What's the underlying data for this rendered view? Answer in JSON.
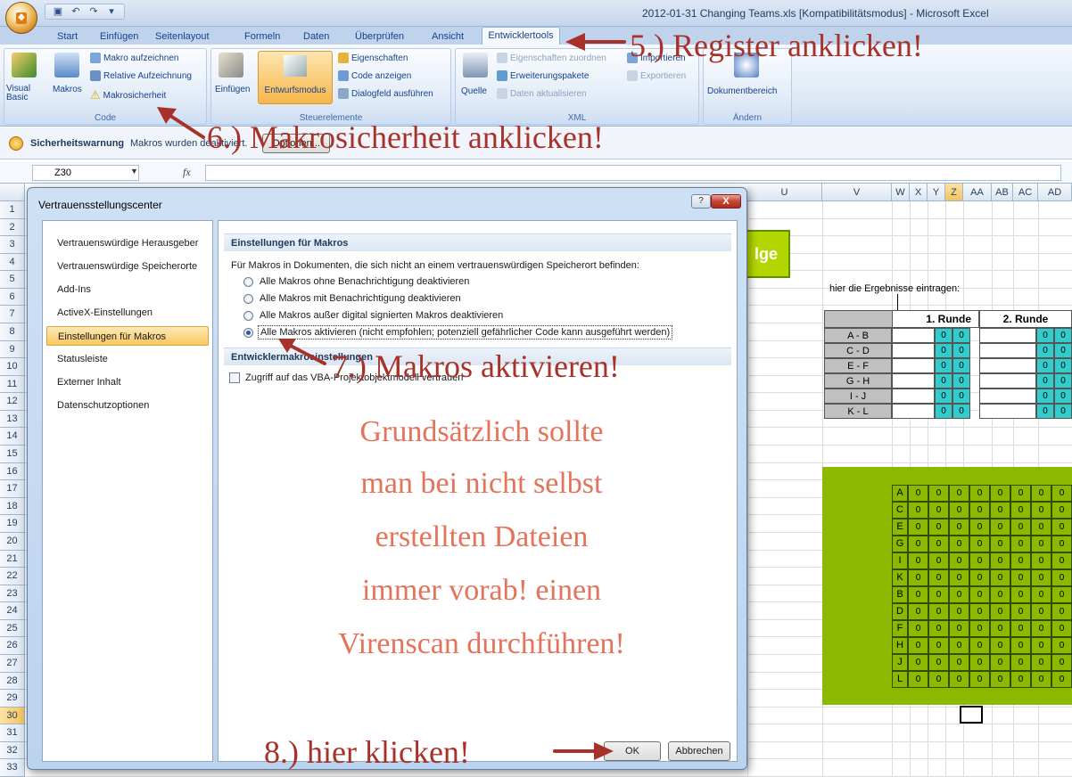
{
  "window": {
    "title": "2012-01-31 Changing Teams.xls [Kompatibilitätsmodus] - Microsoft Excel"
  },
  "ribbon": {
    "tabs": [
      "Start",
      "Einfügen",
      "Seitenlayout",
      "Formeln",
      "Daten",
      "Überprüfen",
      "Ansicht",
      "Entwicklertools"
    ],
    "active_tab": "Entwicklertools",
    "code": {
      "visual_basic": "Visual Basic",
      "makros": "Makros",
      "record": "Makro aufzeichnen",
      "relative": "Relative Aufzeichnung",
      "security": "Makrosicherheit",
      "label": "Code"
    },
    "controls": {
      "insert": "Einfügen",
      "design_mode": "Entwurfsmodus",
      "properties": "Eigenschaften",
      "view_code": "Code anzeigen",
      "run_dialog": "Dialogfeld ausführen",
      "label": "Steuerelemente"
    },
    "xml": {
      "source": "Quelle",
      "map_props": "Eigenschaften zuordnen",
      "expansion": "Erweiterungspakete",
      "refresh": "Daten aktualisieren",
      "import": "Importieren",
      "export": "Exportieren",
      "label": "XML"
    },
    "modify": {
      "doc_panel": "Dokumentbereich",
      "label": "Ändern"
    }
  },
  "security_bar": {
    "title": "Sicherheitswarnung",
    "message": "Makros wurden deaktiviert.",
    "options": "Optionen..."
  },
  "formula_bar": {
    "cell": "Z30",
    "fx": "fx"
  },
  "columns_right": [
    "U",
    "V",
    "W",
    "X",
    "Y",
    "Z",
    "AA",
    "AB",
    "AC",
    "AD"
  ],
  "rows": [
    "1",
    "2",
    "3",
    "4",
    "5",
    "6",
    "7",
    "8",
    "9",
    "10",
    "11",
    "12",
    "13",
    "14",
    "15",
    "16",
    "17",
    "18",
    "19",
    "20",
    "21",
    "22",
    "23",
    "24",
    "25",
    "26",
    "27",
    "28",
    "29",
    "30",
    "31",
    "32",
    "33"
  ],
  "dialog": {
    "title": "Vertrauensstellungscenter",
    "help": "?",
    "close": "X",
    "nav": [
      "Vertrauenswürdige Herausgeber",
      "Vertrauenswürdige Speicherorte",
      "Add-Ins",
      "ActiveX-Einstellungen",
      "Einstellungen für Makros",
      "Statusleiste",
      "Externer Inhalt",
      "Datenschutzoptionen"
    ],
    "selected_nav": "Einstellungen für Makros",
    "section1": "Einstellungen für Makros",
    "intro": "Für Makros in Dokumenten, die sich nicht an einem vertrauenswürdigen Speicherort befinden:",
    "options": [
      "Alle Makros ohne Benachrichtigung deaktivieren",
      "Alle Makros mit Benachrichtigung deaktivieren",
      "Alle Makros außer digital signierten Makros deaktivieren",
      "Alle Makros aktivieren (nicht empfohlen; potenziell gefährlicher Code kann ausgeführt werden)"
    ],
    "selected_option": 3,
    "section2": "Entwicklermakroeinstellungen",
    "vba_trust": "Zugriff auf das VBA-Projektobjektmodell vertrauen",
    "ok": "OK",
    "cancel": "Abbrechen"
  },
  "annotations": {
    "step5": "5.) Register anklicken!",
    "step6": "6.) Makrosicherheit anklicken!",
    "step7": "7.) Makros aktivieren!",
    "step8": "8.) hier klicken!",
    "warning": [
      "Grundsätzlich sollte",
      "man bei nicht selbst",
      "erstellten Dateien",
      "immer vorab! einen",
      "Virenscan durchführen!"
    ]
  },
  "sheet": {
    "banner": "lge",
    "hint": "hier die Ergebnisse eintragen:",
    "round1": "1. Runde",
    "round2": "2. Runde",
    "pairs": [
      "A - B",
      "C - D",
      "E - F",
      "G - H",
      "I - J",
      "K - L"
    ],
    "score": "0",
    "team_letters": [
      "A",
      "C",
      "E",
      "G",
      "I",
      "K",
      "B",
      "D",
      "F",
      "H",
      "J",
      "L"
    ]
  },
  "colors": {
    "accent": "#a8322a",
    "warning_text": "#e4735a",
    "teal": "#33cccc",
    "green": "#8cb800"
  }
}
